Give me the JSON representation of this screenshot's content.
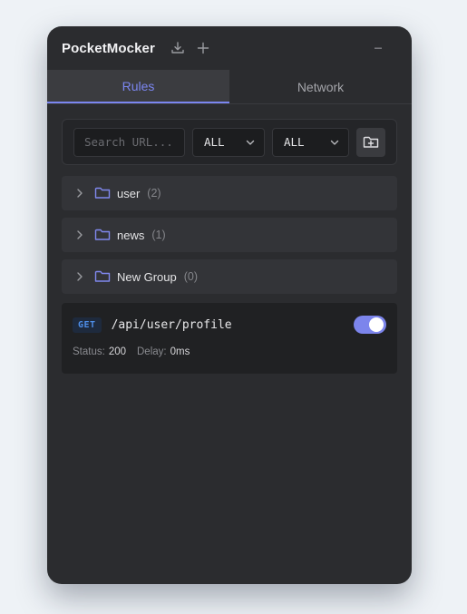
{
  "app": {
    "title": "PocketMocker"
  },
  "tabs": [
    {
      "label": "Rules",
      "active": true
    },
    {
      "label": "Network",
      "active": false
    }
  ],
  "toolbar": {
    "search_placeholder": "Search URL...",
    "method_filter": "ALL",
    "status_filter": "ALL"
  },
  "groups": [
    {
      "name": "user",
      "count": "(2)"
    },
    {
      "name": "news",
      "count": "(1)"
    },
    {
      "name": "New Group",
      "count": "(0)"
    }
  ],
  "rule": {
    "method": "GET",
    "path": "/api/user/profile",
    "enabled": true,
    "status_label": "Status:",
    "status": "200",
    "delay_label": "Delay:",
    "delay": "0ms"
  },
  "colors": {
    "accent": "#7b86f0",
    "panel_bg": "#2b2c2f",
    "method_get": "#4e8ee8"
  },
  "icons": {
    "export": "download-icon",
    "add": "plus-icon",
    "minimize": "minus-icon",
    "new_folder": "folder-plus-icon",
    "group_toggle": "chevron-right-icon",
    "group": "folder-icon"
  }
}
